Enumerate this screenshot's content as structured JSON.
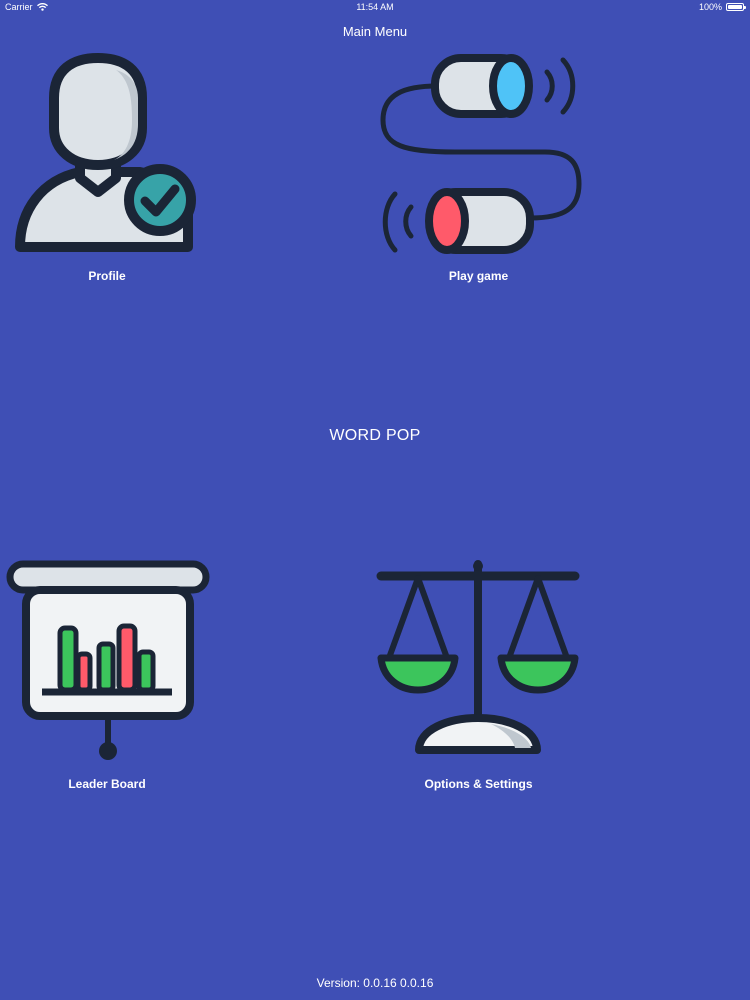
{
  "status_bar": {
    "carrier": "Carrier",
    "time": "11:54 AM",
    "battery": "100%",
    "battery_level": 1.0
  },
  "nav": {
    "title": "Main Menu"
  },
  "menu": {
    "profile": {
      "label": "Profile",
      "icon": "user-check-icon"
    },
    "play_game": {
      "label": "Play game",
      "icon": "tin-can-phone-icon"
    },
    "leader_board": {
      "label": "Leader Board",
      "icon": "presentation-chart-icon"
    },
    "options_settings": {
      "label": "Options & Settings",
      "icon": "balance-scale-icon"
    }
  },
  "app": {
    "title": "WORD POP"
  },
  "footer": {
    "version": "Version: 0.0.16 0.0.16"
  },
  "colors": {
    "background": "#3F4FB5",
    "outline": "#1B2536",
    "light_fill": "#DDE3E8",
    "accent_teal": "#37A3A8",
    "accent_blue": "#4FC3F7",
    "accent_red": "#FF5A6A",
    "accent_green": "#3CC55C"
  }
}
